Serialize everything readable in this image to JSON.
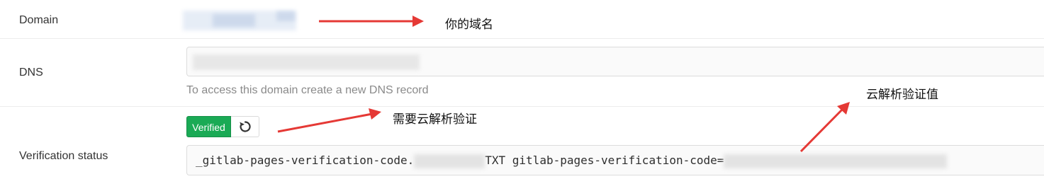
{
  "fields": {
    "domain_label": "Domain",
    "dns_label": "DNS",
    "dns_help": "To access this domain create a new DNS record",
    "verification_label": "Verification status"
  },
  "verification": {
    "badge": "Verified",
    "code_prefix": "_gitlab-pages-verification-code.",
    "code_middle": "TXT gitlab-pages-verification-code="
  },
  "annotations": {
    "domain_note": "你的域名",
    "need_verify_note": "需要云解析验证",
    "verify_value_note": "云解析验证值"
  },
  "colors": {
    "badge_green": "#1aaa55",
    "arrow_red": "#e53935"
  },
  "icons": {
    "retry": "retry-icon"
  }
}
